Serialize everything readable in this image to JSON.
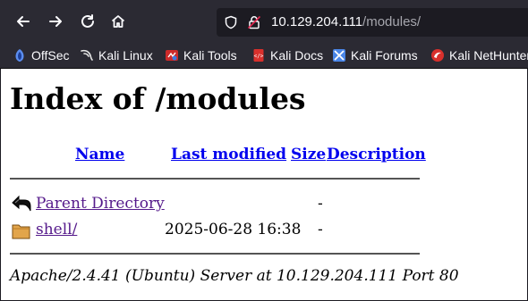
{
  "browser": {
    "url_host": "10.129.204.111",
    "url_path": "/modules/"
  },
  "bookmarks": [
    {
      "label": "OffSec",
      "icon": "offsec-icon"
    },
    {
      "label": "Kali Linux",
      "icon": "kali-dragon-icon"
    },
    {
      "label": "Kali Tools",
      "icon": "kali-tools-icon"
    },
    {
      "label": "Kali Docs",
      "icon": "kali-docs-icon"
    },
    {
      "label": "Kali Forums",
      "icon": "kali-forums-icon"
    },
    {
      "label": "Kali NetHunter",
      "icon": "kali-nethunter-icon"
    }
  ],
  "page": {
    "heading": "Index of /modules",
    "columns": {
      "name": "Name",
      "last_modified": "Last modified",
      "size": "Size",
      "description": "Description"
    },
    "rows": [
      {
        "name": "Parent Directory",
        "modified": "",
        "size": "-",
        "icon": "back-arrow-icon"
      },
      {
        "name": "shell/",
        "modified": "2025-06-28 16:38",
        "size": "-",
        "icon": "folder-icon"
      }
    ],
    "footer": "Apache/2.4.41 (Ubuntu) Server at 10.129.204.111 Port 80"
  },
  "colors": {
    "toolbar": "#2b2a33",
    "link": "#0000ee",
    "visited_link": "#551a8b"
  }
}
